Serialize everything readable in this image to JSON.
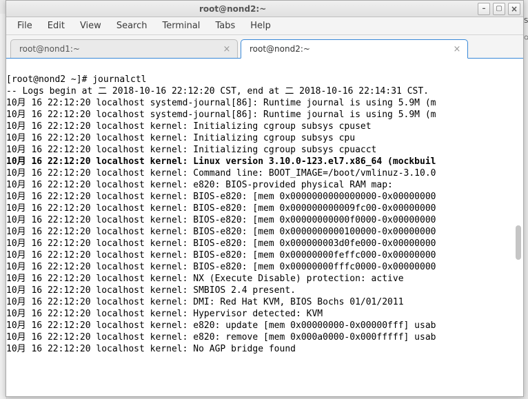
{
  "bg_right_text": "SD",
  "titlebar": {
    "title": "root@nond2:~",
    "minimize": "–",
    "maximize": "▢",
    "close": "×"
  },
  "menubar": [
    "File",
    "Edit",
    "View",
    "Search",
    "Terminal",
    "Tabs",
    "Help"
  ],
  "tabs": [
    {
      "label": "root@nond1:~",
      "active": false
    },
    {
      "label": "root@nond2:~",
      "active": true
    }
  ],
  "terminal_lines": [
    {
      "bold": false,
      "text": "[root@nond2 ~]# journalctl"
    },
    {
      "bold": false,
      "text": "-- Logs begin at 二 2018-10-16 22:12:20 CST, end at 二 2018-10-16 22:14:31 CST."
    },
    {
      "bold": false,
      "text": "10月 16 22:12:20 localhost systemd-journal[86]: Runtime journal is using 5.9M (m"
    },
    {
      "bold": false,
      "text": "10月 16 22:12:20 localhost systemd-journal[86]: Runtime journal is using 5.9M (m"
    },
    {
      "bold": false,
      "text": "10月 16 22:12:20 localhost kernel: Initializing cgroup subsys cpuset"
    },
    {
      "bold": false,
      "text": "10月 16 22:12:20 localhost kernel: Initializing cgroup subsys cpu"
    },
    {
      "bold": false,
      "text": "10月 16 22:12:20 localhost kernel: Initializing cgroup subsys cpuacct"
    },
    {
      "bold": true,
      "text": "10月 16 22:12:20 localhost kernel: Linux version 3.10.0-123.el7.x86_64 (mockbuil"
    },
    {
      "bold": false,
      "text": "10月 16 22:12:20 localhost kernel: Command line: BOOT_IMAGE=/boot/vmlinuz-3.10.0"
    },
    {
      "bold": false,
      "text": "10月 16 22:12:20 localhost kernel: e820: BIOS-provided physical RAM map:"
    },
    {
      "bold": false,
      "text": "10月 16 22:12:20 localhost kernel: BIOS-e820: [mem 0x0000000000000000-0x00000000"
    },
    {
      "bold": false,
      "text": "10月 16 22:12:20 localhost kernel: BIOS-e820: [mem 0x000000000009fc00-0x00000000"
    },
    {
      "bold": false,
      "text": "10月 16 22:12:20 localhost kernel: BIOS-e820: [mem 0x00000000000f0000-0x00000000"
    },
    {
      "bold": false,
      "text": "10月 16 22:12:20 localhost kernel: BIOS-e820: [mem 0x0000000000100000-0x00000000"
    },
    {
      "bold": false,
      "text": "10月 16 22:12:20 localhost kernel: BIOS-e820: [mem 0x000000003d0fe000-0x00000000"
    },
    {
      "bold": false,
      "text": "10月 16 22:12:20 localhost kernel: BIOS-e820: [mem 0x00000000feffc000-0x00000000"
    },
    {
      "bold": false,
      "text": "10月 16 22:12:20 localhost kernel: BIOS-e820: [mem 0x00000000fffc0000-0x00000000"
    },
    {
      "bold": false,
      "text": "10月 16 22:12:20 localhost kernel: NX (Execute Disable) protection: active"
    },
    {
      "bold": false,
      "text": "10月 16 22:12:20 localhost kernel: SMBIOS 2.4 present."
    },
    {
      "bold": false,
      "text": "10月 16 22:12:20 localhost kernel: DMI: Red Hat KVM, BIOS Bochs 01/01/2011"
    },
    {
      "bold": false,
      "text": "10月 16 22:12:20 localhost kernel: Hypervisor detected: KVM"
    },
    {
      "bold": false,
      "text": "10月 16 22:12:20 localhost kernel: e820: update [mem 0x00000000-0x00000fff] usab"
    },
    {
      "bold": false,
      "text": "10月 16 22:12:20 localhost kernel: e820: remove [mem 0x000a0000-0x000fffff] usab"
    },
    {
      "bold": false,
      "text": "10月 16 22:12:20 localhost kernel: No AGP bridge found"
    }
  ]
}
